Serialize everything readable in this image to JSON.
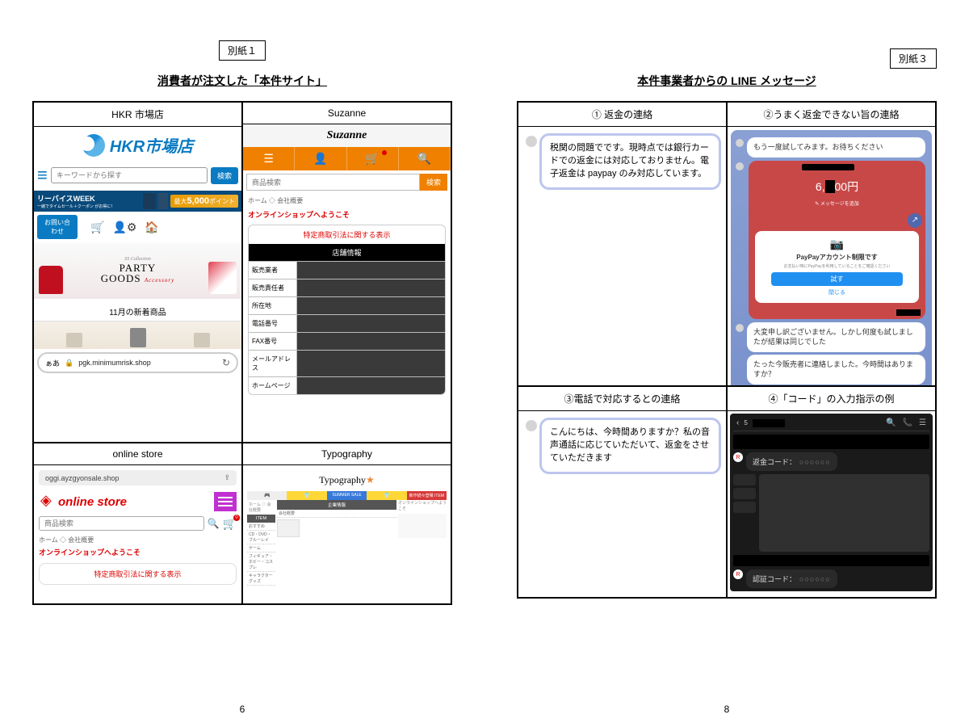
{
  "page1": {
    "tag": "別紙１",
    "title": "消費者が注文した「本件サイト」",
    "page_num": "6",
    "sites": {
      "hkr": {
        "name": "HKR 市場店",
        "logo_text": "HKR市場店",
        "search_placeholder": "キーワードから探す",
        "search_btn": "検索",
        "banner_title": "リーバイスWEEK",
        "banner_sub": "一緒でタイムセール＋クーポン がお得に！",
        "banner_points_prefix": "最大",
        "banner_points_val": "5,000",
        "banner_points_suffix": "ポイント",
        "contact": "お問い合わせ",
        "party_ss": "SS Collection",
        "party_main": "PARTY",
        "party_goods": "GOODS",
        "party_acc": "Accessory",
        "new_items": "11月の新着商品",
        "addr_aa": "ぁあ",
        "url": "pgk.minimumrisk.shop"
      },
      "suzanne": {
        "name": "Suzanne",
        "logo": "Suzanne",
        "search_placeholder": "商品検索",
        "search_btn": "検索",
        "crumb": "ホーム ◇ 会社概要",
        "welcome": "オンラインショップへようこそ",
        "law_title": "特定商取引法に関する表示",
        "store_info": "店舗情報",
        "rows": [
          "販売業者",
          "販売責任者",
          "所在地",
          "電話番号",
          "FAX番号",
          "メールアドレス",
          "ホームページ"
        ]
      },
      "online_store": {
        "name": "online store",
        "url": "oggi.ayzgyonsale.shop",
        "logo": "online store",
        "search_placeholder": "商品検索",
        "crumb": "ホーム ◇ 会社概要",
        "welcome": "オンラインショップへようこそ",
        "law_title": "特定商取引法に関する表示"
      },
      "typography": {
        "name": "Typography",
        "logo": "Typography",
        "sale": "SUMMER SALE",
        "new_items_label": "新作続々登場 ITEM",
        "side_head1": "ITEM",
        "side_items1": [
          "おすすめ",
          "CD・DVD・ブルーレイ",
          "ゲーム",
          "フィギュア・ホビー・コスプレ",
          "キャラクターグッズ"
        ],
        "side_head2": "企業情報",
        "side_items2": [
          "会社概要"
        ],
        "right_text": "オンラインショップへようこそ"
      }
    }
  },
  "page2": {
    "tag": "別紙３",
    "title": "本件事業者からの LINE メッセージ",
    "page_num": "8",
    "cells": {
      "c1": {
        "header": "① 返金の連絡",
        "msg": "税関の問題でです。現時点では銀行カードでの返金には対応しておりません。電子返金は paypay のみ対応しています。"
      },
      "c2": {
        "header": "②うまく返金できない旨の連絡",
        "msg1": "もう一度試してみます。お待ちください",
        "amount_prefix": "6,",
        "amount_suffix": "00円",
        "pay_title": "PayPayアカウント制限です",
        "pay_sub": "お支払い時にPayPayを利用していることをご確認ください",
        "pay_btn": "試す",
        "pay_cancel": "閉じる",
        "msg2": "大変申し訳ございません。しかし何度も試しましたが結果は同じでした",
        "msg3": "たった今販売者に連絡しました。今時間はありますか？"
      },
      "c3": {
        "header": "③電話で対応するとの連絡",
        "msg": "こんにちは、今時間ありますか？私の音声通話に応じていただいて、返金をさせていただきます"
      },
      "c4": {
        "header": "④「コード」の入力指示の例",
        "back": "5",
        "refund_label": "返金コード：",
        "auth_label": "認証コード：",
        "mask": "○○○○○○"
      }
    }
  }
}
